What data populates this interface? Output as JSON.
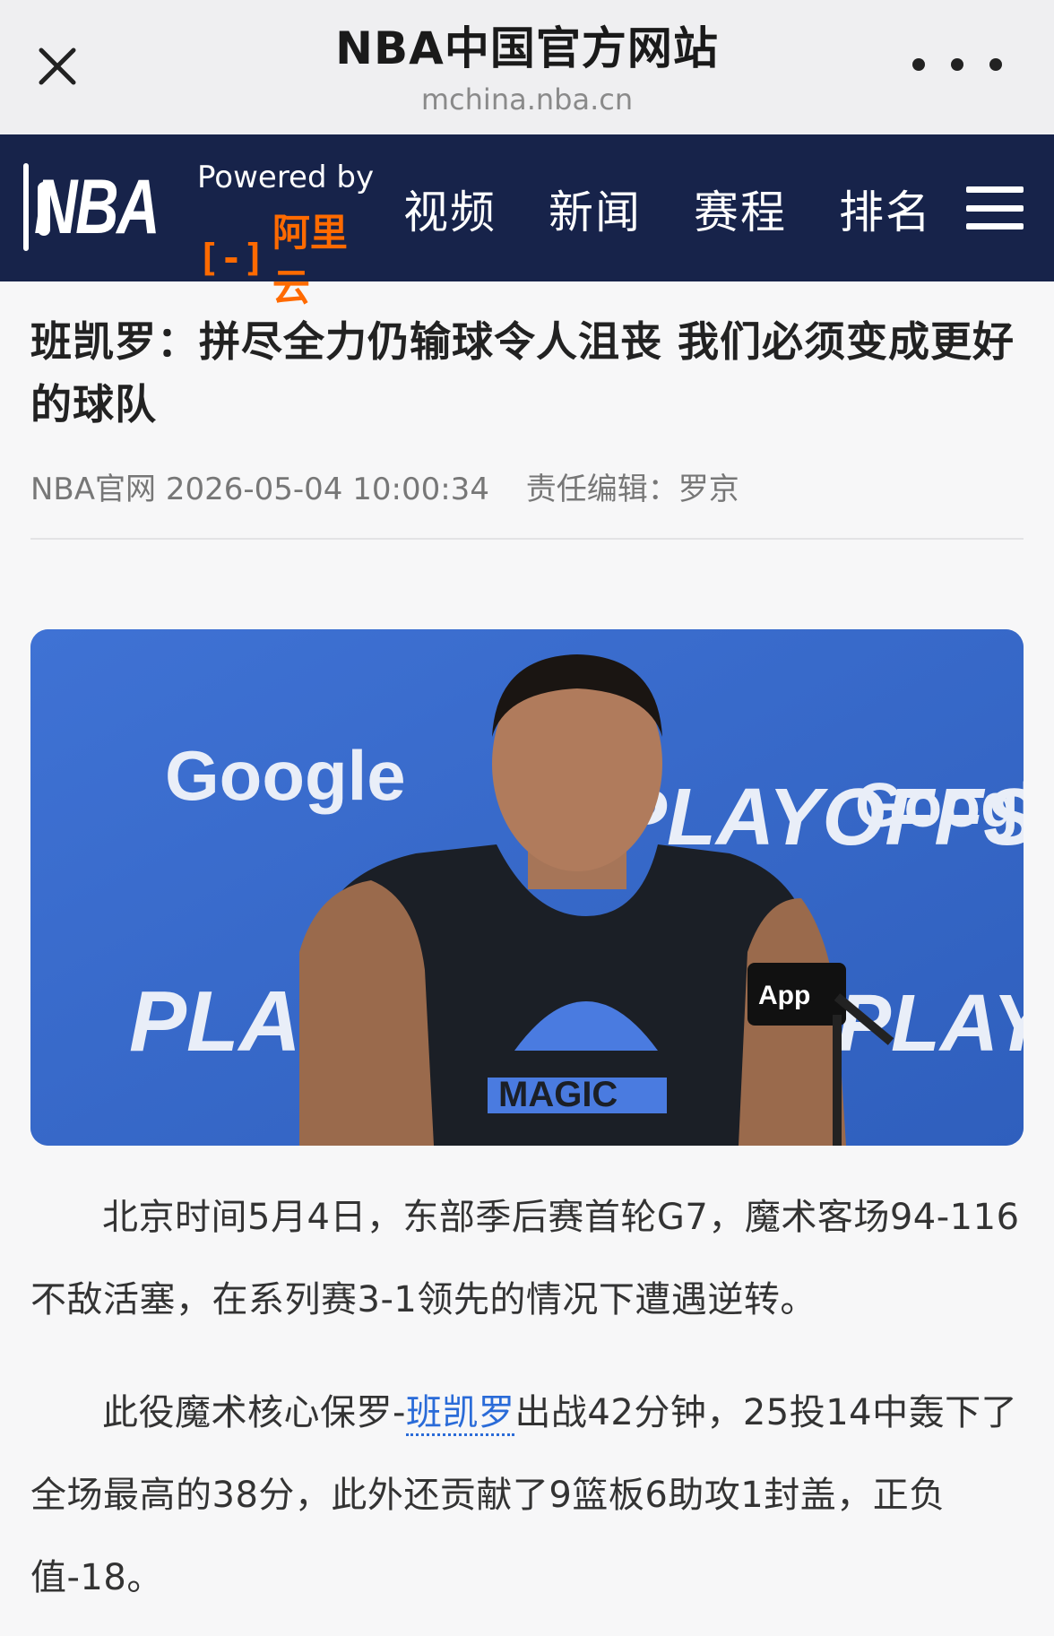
{
  "topbar": {
    "title": "NBA中国官方网站",
    "url": "mchina.nba.cn"
  },
  "header": {
    "logo_text": "NBA",
    "powered_by": "Powered by",
    "sponsor": "阿里云",
    "nav": [
      "视频",
      "新闻",
      "赛程",
      "排名"
    ]
  },
  "article": {
    "headline": "班凯罗：拼尽全力仍输球令人沮丧 我们必须变成更好的球队",
    "source": "NBA官网",
    "datetime": "2026-05-04 10:00:34",
    "editor": "责任编辑：罗京",
    "photo_texts": {
      "google": "Google",
      "playoffs": "PLAYOFFS",
      "jersey": "MAGIC",
      "mic": "App"
    },
    "para1": "北京时间5月4日，东部季后赛首轮G7，魔术客场94-116不敌活塞，在系列赛3-1领先的情况下遭遇逆转。",
    "para2_before": "此役魔术核心保罗-",
    "para2_link": "班凯罗",
    "para2_after": "出战42分钟，25投14中轰下了全场最高的38分，此外还贡献了9篮板6助攻1封盖，正负值-18。"
  },
  "colors": {
    "header_bg": "#17234a",
    "sponsor_orange": "#ff6a00",
    "link_blue": "#2a6bd8",
    "backdrop_blue": "#3b6ccd"
  }
}
